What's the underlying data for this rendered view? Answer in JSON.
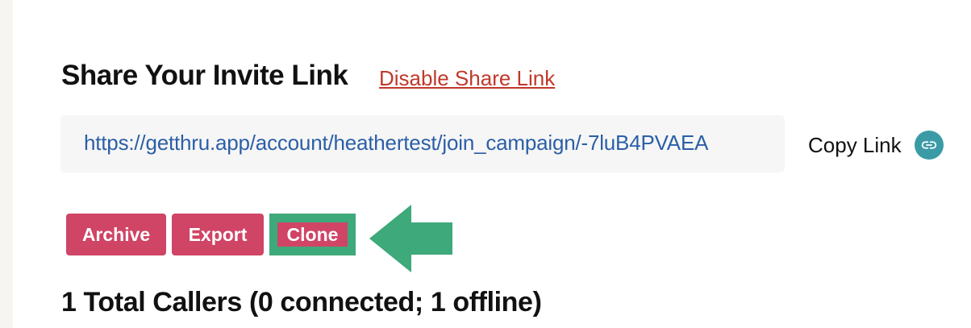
{
  "share": {
    "title": "Share Your Invite Link",
    "disable_label": "Disable Share Link",
    "url": "https://getthru.app/account/heathertest/join_campaign/-7luB4PVAEA",
    "copy_label": "Copy Link",
    "copy_icon": "link-icon"
  },
  "actions": {
    "archive_label": "Archive",
    "export_label": "Export",
    "clone_label": "Clone",
    "highlight_icon": "left-arrow-icon"
  },
  "callers": {
    "heading": "1 Total Callers (0 connected; 1 offline)"
  },
  "colors": {
    "button": "#d04466",
    "highlight": "#3ea97a",
    "link": "#c0392b",
    "url": "#2b5fa6",
    "copy_icon_bg": "#3a9ba6"
  }
}
